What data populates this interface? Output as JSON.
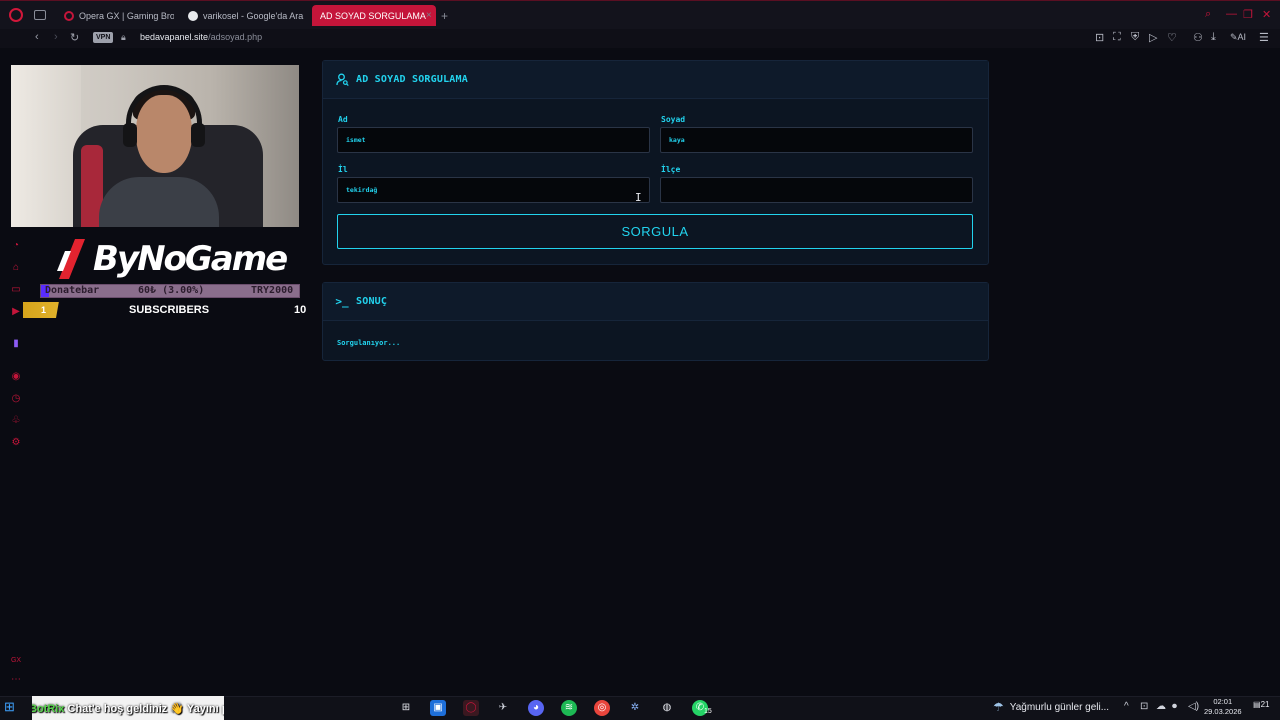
{
  "browser": {
    "tabs": [
      {
        "title": "Opera GX | Gaming Browse",
        "favicon_color": "#c4153a",
        "active": false
      },
      {
        "title": "varikosel - Google'da Ara",
        "favicon_color": "#e8eaed",
        "active": false
      },
      {
        "title": "AD SOYAD SORGULAMA",
        "favicon_color": "#ffffff",
        "active": true
      }
    ],
    "new_tab_icon": "plus-icon",
    "vpn_label": "VPN",
    "url_host": "bedavapanel.site",
    "url_path": "/adsoyad.php",
    "ai_label": "AI"
  },
  "stream": {
    "brand_name": "ByNoGame",
    "donate": {
      "label": "Donatebar",
      "amount": "60₺ (3.00%)",
      "goal": "TRY2000",
      "progress_percent": 3
    },
    "subscribers": {
      "left_count": "1",
      "label": "SUBSCRIBERS",
      "right_count": "10"
    }
  },
  "form": {
    "title": "AD SOYAD SORGULAMA",
    "title_icon": "user-search-icon",
    "fields": {
      "ad": {
        "label": "Ad",
        "value": "ismet"
      },
      "soyad": {
        "label": "Soyad",
        "value": "kaya"
      },
      "il": {
        "label": "İl",
        "value": "tekirdağ"
      },
      "ilce": {
        "label": "İlçe",
        "value": ""
      }
    },
    "submit_label": "SORGULA"
  },
  "result": {
    "title": "SONUÇ",
    "title_icon": "terminal-prompt-icon",
    "status_text": "Sorgulanıyor..."
  },
  "taskbar": {
    "ticker_bot": "BotRix",
    "ticker_message": "Chat'e hoş geldiniz 👋 Yayını paylaşarak destek olabilirsiniz 💚",
    "weather_text": "Yağmurlu günler geli...",
    "time": "02:01",
    "date": "29.03.2026",
    "notification_count": "21",
    "whatsapp_badge": "15"
  },
  "colors": {
    "accent": "#22d3ee",
    "opera_red": "#c4153a",
    "panel_bg": "#0c1522",
    "page_bg": "#0a0b12"
  }
}
